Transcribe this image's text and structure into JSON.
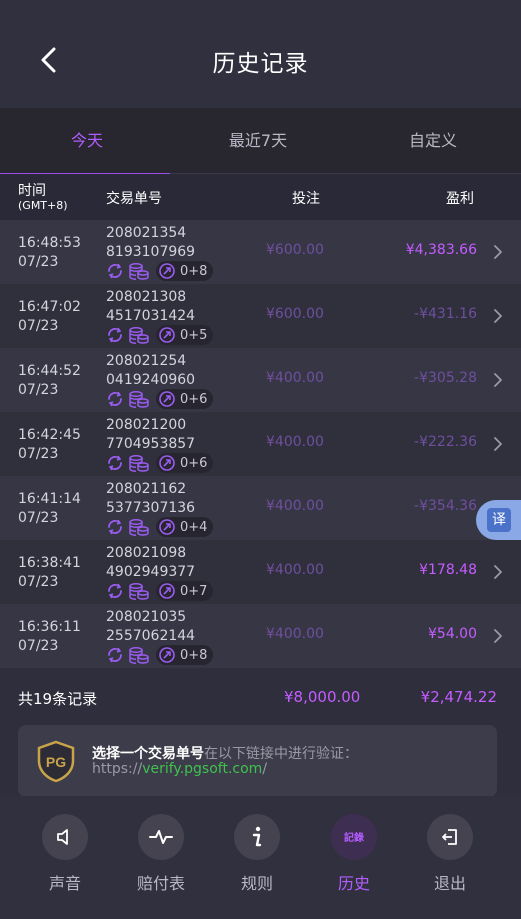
{
  "header": {
    "title": "历史记录"
  },
  "tabs": [
    {
      "label": "今天",
      "active": true
    },
    {
      "label": "最近7天",
      "active": false
    },
    {
      "label": "自定义",
      "active": false
    }
  ],
  "columns": {
    "time": "时间",
    "time_sub": "(GMT+8)",
    "order": "交易单号",
    "bet": "投注",
    "profit": "盈利"
  },
  "rows": [
    {
      "time": "16:48:53",
      "date": "07/23",
      "order1": "208021354",
      "order2": "8193107969",
      "combo": "0+8",
      "bet": "¥600.00",
      "profit": "¥4,383.66",
      "positive": true
    },
    {
      "time": "16:47:02",
      "date": "07/23",
      "order1": "208021308",
      "order2": "4517031424",
      "combo": "0+5",
      "bet": "¥600.00",
      "profit": "-¥431.16",
      "positive": false
    },
    {
      "time": "16:44:52",
      "date": "07/23",
      "order1": "208021254",
      "order2": "0419240960",
      "combo": "0+6",
      "bet": "¥400.00",
      "profit": "-¥305.28",
      "positive": false
    },
    {
      "time": "16:42:45",
      "date": "07/23",
      "order1": "208021200",
      "order2": "7704953857",
      "combo": "0+6",
      "bet": "¥400.00",
      "profit": "-¥222.36",
      "positive": false
    },
    {
      "time": "16:41:14",
      "date": "07/23",
      "order1": "208021162",
      "order2": "5377307136",
      "combo": "0+4",
      "bet": "¥400.00",
      "profit": "-¥354.36",
      "positive": false
    },
    {
      "time": "16:38:41",
      "date": "07/23",
      "order1": "208021098",
      "order2": "4902949377",
      "combo": "0+7",
      "bet": "¥400.00",
      "profit": "¥178.48",
      "positive": true
    },
    {
      "time": "16:36:11",
      "date": "07/23",
      "order1": "208021035",
      "order2": "2557062144",
      "combo": "0+8",
      "bet": "¥400.00",
      "profit": "¥54.00",
      "positive": true
    }
  ],
  "translate": {
    "label": "译"
  },
  "summary": {
    "count_label": "共19条记录",
    "total_bet": "¥8,000.00",
    "total_profit": "¥2,474.22"
  },
  "verify": {
    "logo_text": "PG",
    "bold": "选择一个交易单号",
    "rest": "在以下链接中进行验证：",
    "url_prefix": "https://",
    "url_link": "verify.pgsoft.com",
    "url_suffix": "/"
  },
  "footer": [
    {
      "label": "声音",
      "icon": "sound-icon",
      "active": false
    },
    {
      "label": "赔付表",
      "icon": "paytable-icon",
      "active": false
    },
    {
      "label": "规则",
      "icon": "info-icon",
      "active": false
    },
    {
      "label": "历史",
      "icon": "history-icon",
      "icon_text": "記錄",
      "active": true
    },
    {
      "label": "退出",
      "icon": "exit-icon",
      "active": false
    }
  ],
  "colors": {
    "accent": "#b35cff",
    "positive": "#c45cff",
    "muted_bet": "#6e4f9d",
    "link": "#3ec24e"
  }
}
